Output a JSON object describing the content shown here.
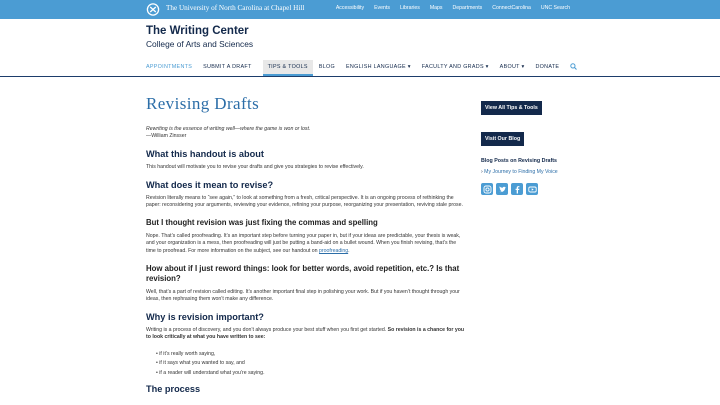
{
  "topbar": {
    "university": "The University of North Carolina at Chapel Hill",
    "links": [
      "Accessibility",
      "Events",
      "Libraries",
      "Maps",
      "Departments",
      "ConnectCarolina",
      "UNC Search"
    ]
  },
  "header": {
    "title": "The Writing Center",
    "subtitle": "College of Arts and Sciences"
  },
  "nav": {
    "items": [
      "APPOINTMENTS",
      "SUBMIT A DRAFT",
      "TIPS & TOOLS",
      "BLOG",
      "ENGLISH LANGUAGE ▾",
      "FACULTY AND GRADS ▾",
      "ABOUT ▾",
      "DONATE"
    ]
  },
  "main": {
    "title": "Revising Drafts",
    "quote": "Rewriting is the essence of writing well—where the game is won or lost.",
    "quote_author": "—William Zinsser",
    "s1_heading": "What this handout is about",
    "s1_p": "This handout will motivate you to revise your drafts and give you strategies to revise effectively.",
    "s2_heading": "What does it mean to revise?",
    "s2_p": "Revision literally means to “see again,” to look at something from a fresh, critical perspective. It is an ongoing process of rethinking the paper: reconsidering your arguments, reviewing your evidence, refining your purpose, reorganizing your presentation, reviving stale prose.",
    "s3_heading": "But I thought revision was just fixing the commas and spelling",
    "s3_p": "Nope. That’s called proofreading. It’s an important step before turning your paper in, but if your ideas are predictable, your thesis is weak, and your organization is a mess, then proofreading will just be putting a band-aid on a bullet wound. When you finish revising, that’s the time to proofread. For more information on the subject, see our handout on ",
    "s3_link": "proofreading",
    "s3_end": ".",
    "s4_heading": "How about if I just reword things: look for better words, avoid repetition, etc.? Is that revision?",
    "s4_p": "Well, that’s a part of revision called editing. It’s another important final step in polishing your work. But if you haven’t thought through your ideas, then rephrasing them won’t make any difference.",
    "s5_heading": "Why is revision important?",
    "s5_p": "Writing is a process of discovery, and you don’t always produce your best stuff when you first get started. ",
    "s5_bold": "So revision is a chance for you to look critically at what you have written to see:",
    "bullets": [
      "if it’s really worth saying,",
      "if it says what you wanted to say, and",
      "if a reader will understand what you’re saying."
    ],
    "s6_heading": "The process"
  },
  "sidebar": {
    "btn_tips": "View All Tips & Tools",
    "btn_blog": "Visit Our Blog",
    "posts_heading": "Blog Posts on Revising Drafts",
    "post_link": "My Journey to Finding My Voice"
  },
  "colors": {
    "brand": "#4b9cd3",
    "navy": "#13294b",
    "title_blue": "#2c6ea8"
  },
  "icons": [
    "unc-logo-icon",
    "search-icon",
    "instagram-icon",
    "twitter-icon",
    "facebook-icon",
    "youtube-icon"
  ]
}
